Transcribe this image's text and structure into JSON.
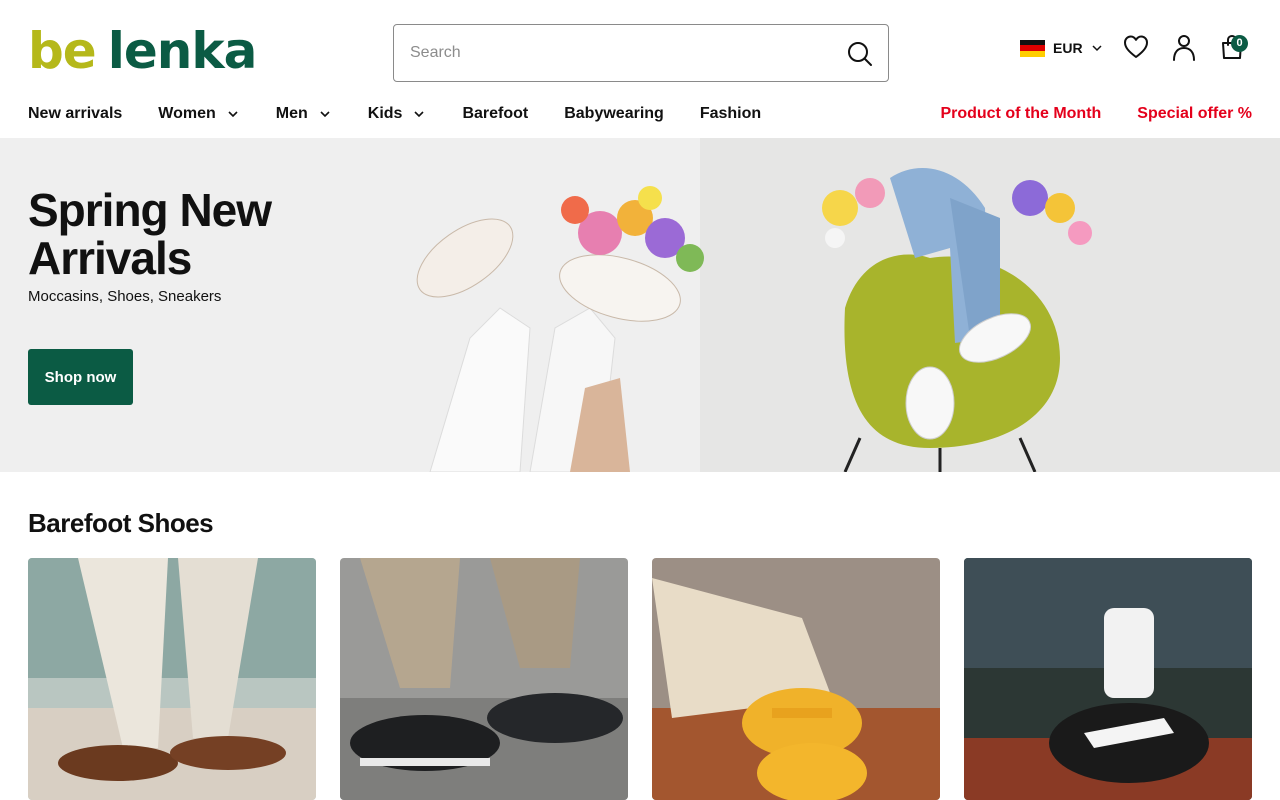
{
  "brand": {
    "logo_part1": "be",
    "logo_part2": "lenka"
  },
  "search": {
    "placeholder": "Search"
  },
  "currency": {
    "code": "EUR",
    "flag": "germany-flag"
  },
  "cart": {
    "count": "0"
  },
  "nav": {
    "items": [
      {
        "label": "New arrivals",
        "dropdown": false
      },
      {
        "label": "Women",
        "dropdown": true
      },
      {
        "label": "Men",
        "dropdown": true
      },
      {
        "label": "Kids",
        "dropdown": true
      },
      {
        "label": "Barefoot",
        "dropdown": false
      },
      {
        "label": "Babywearing",
        "dropdown": false
      },
      {
        "label": "Fashion",
        "dropdown": false
      }
    ],
    "promo": [
      "Product of the Month",
      "Special offer %"
    ]
  },
  "hero": {
    "title": "Spring New Arrivals",
    "subtitle": "Moccasins, Shoes, Sneakers",
    "cta": "Shop now"
  },
  "section": {
    "title": "Barefoot Shoes"
  },
  "colors": {
    "brand_green": "#0b5b44",
    "brand_lime": "#b5b81a",
    "promo_red": "#e4001b"
  }
}
